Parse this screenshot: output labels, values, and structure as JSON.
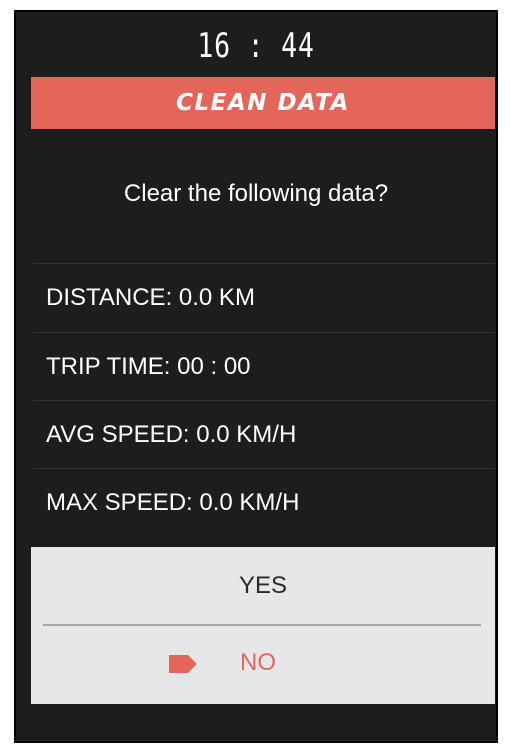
{
  "status": {
    "time": "16 : 44"
  },
  "header": {
    "title": "CLEAN DATA"
  },
  "dialog": {
    "prompt": "Clear the following data?",
    "items": [
      {
        "label": "DISTANCE: 0.0 KM"
      },
      {
        "label": "TRIP TIME: 00 : 00"
      },
      {
        "label": "AVG SPEED: 0.0 KM/H"
      },
      {
        "label": "MAX SPEED: 0.0 KM/H"
      }
    ],
    "options": {
      "yes": "YES",
      "no": "NO",
      "selected": "NO"
    }
  },
  "colors": {
    "background": "#1d1d1d",
    "accent": "#e4665b",
    "text": "#ffffff",
    "dialog_bg": "#e6e7e9"
  },
  "icons": {
    "selector": "pointer-tag-icon"
  }
}
